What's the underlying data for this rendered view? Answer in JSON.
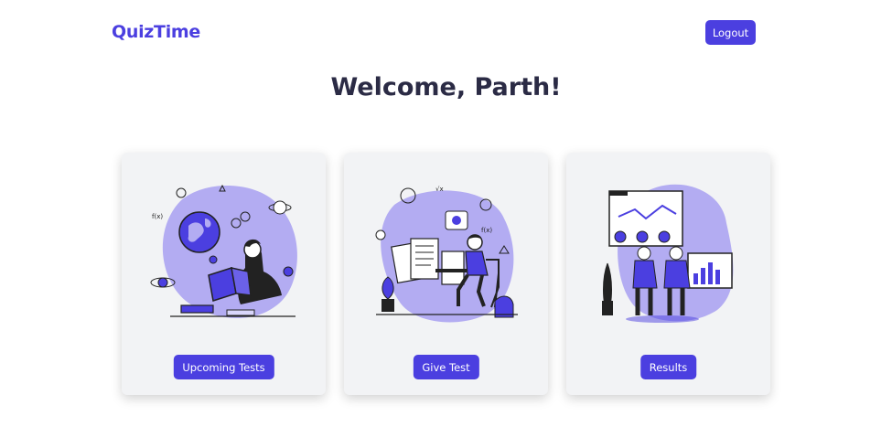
{
  "header": {
    "logo_text": "QuizTime",
    "logout_label": "Logout"
  },
  "welcome_title": "Welcome, Parth!",
  "cards": [
    {
      "button_label": "Upcoming Tests",
      "illustration": "student-reading-book-icon"
    },
    {
      "button_label": "Give Test",
      "illustration": "student-taking-test-icon"
    },
    {
      "button_label": "Results",
      "illustration": "people-viewing-charts-icon"
    }
  ],
  "colors": {
    "accent": "#4b3fe0",
    "illustration_blob": "#b3acf2",
    "card_bg": "#f2f3f5",
    "title_text": "#2b2b45"
  }
}
